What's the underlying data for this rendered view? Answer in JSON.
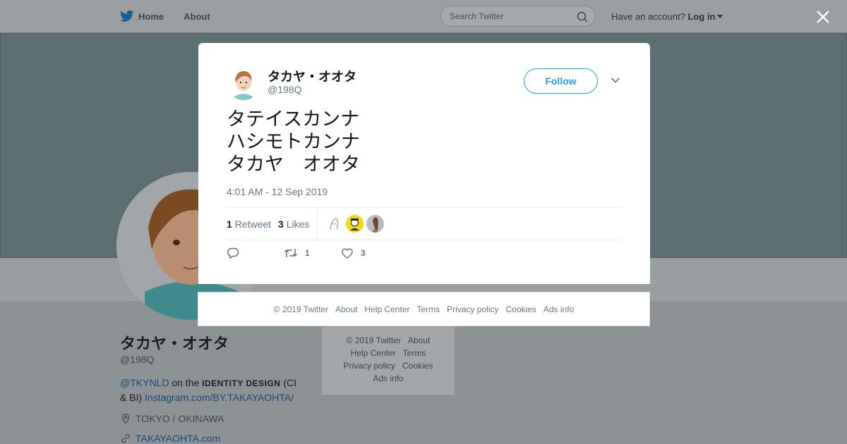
{
  "topbar": {
    "nav": [
      {
        "label": "Home",
        "icon": "twitter-bird-icon"
      },
      {
        "label": "About"
      }
    ],
    "search_placeholder": "Search Twitter",
    "account_prompt": "Have an account?",
    "login_label": "Log in"
  },
  "profile": {
    "name": "タカヤ・オオタ",
    "handle": "@198Q",
    "bio": {
      "mention": "@TKYNLD",
      "text1": " on the ",
      "bold": "IDENTITY DESIGN",
      "text2": " (CI & BI) ",
      "link": "Instagram.com/BY.TAKAYAOHTA/"
    },
    "location": "TOKYO / OKINAWA",
    "website": "TAKAYAOHTA.com",
    "banner_color": "#5c6e70"
  },
  "background_footer": {
    "row1": [
      "© 2019 Twitter",
      "About"
    ],
    "row2": [
      "Help Center",
      "Terms"
    ],
    "row3": [
      "Privacy policy",
      "Cookies"
    ],
    "row4": [
      "Ads info"
    ]
  },
  "tweet": {
    "author_name": "タカヤ・オオタ",
    "author_handle": "@198Q",
    "follow_label": "Follow",
    "lines": [
      "タテイスカンナ",
      "ハシモトカンナ",
      "タカヤ　オオタ"
    ],
    "timestamp": "4:01 AM - 12 Sep 2019",
    "retweet_count": "1",
    "retweet_label": "Retweet",
    "like_count": "3",
    "like_label": "Likes",
    "action_retweet_count": "1",
    "action_like_count": "3"
  },
  "modal_footer": [
    "© 2019 Twitter",
    "About",
    "Help Center",
    "Terms",
    "Privacy policy",
    "Cookies",
    "Ads info"
  ],
  "colors": {
    "accent": "#1da1f2",
    "muted": "#657786"
  }
}
